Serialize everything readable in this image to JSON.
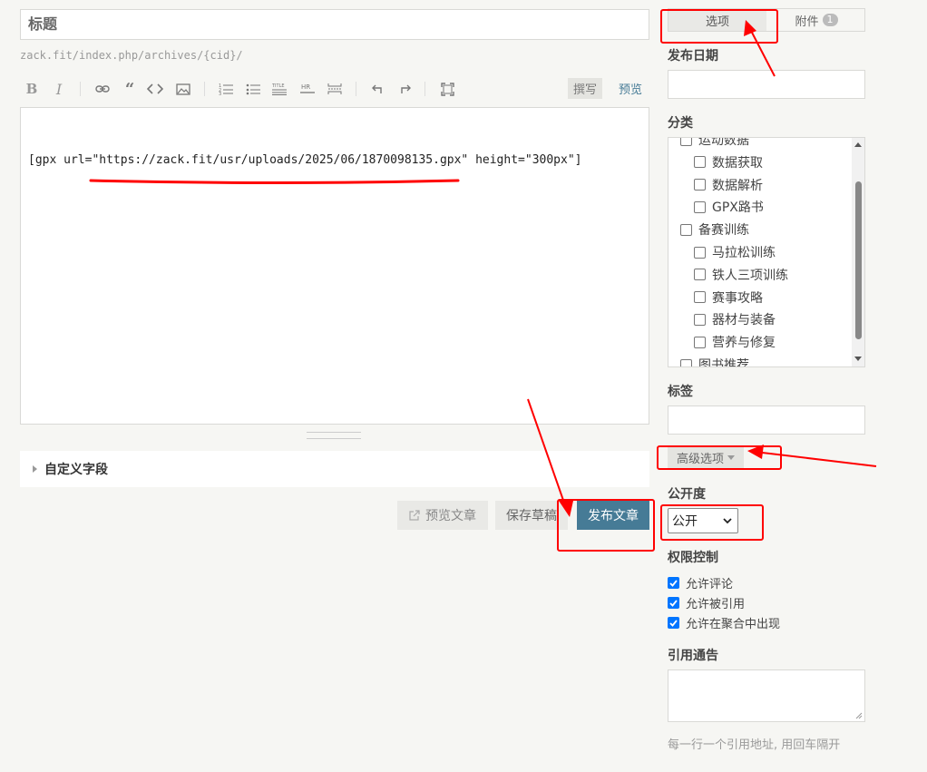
{
  "editor": {
    "title_placeholder": "标题",
    "permalink": "zack.fit/index.php/archives/{cid}/",
    "toolbar": {
      "bold": "B",
      "italic": "I",
      "write_tab": "撰写",
      "preview_tab": "预览"
    },
    "content": "[gpx url=\"https://zack.fit/usr/uploads/2025/06/1870098135.gpx\" height=\"300px\"]",
    "custom_fields_label": "自定义字段",
    "buttons": {
      "preview": "预览文章",
      "save_draft": "保存草稿",
      "publish": "发布文章"
    }
  },
  "sidebar": {
    "tabs": {
      "options": "选项",
      "attachments": "附件",
      "attachments_count": "1"
    },
    "publish_date_label": "发布日期",
    "category_label": "分类",
    "categories": [
      {
        "label": "运动数据",
        "level": 0
      },
      {
        "label": "数据获取",
        "level": 1
      },
      {
        "label": "数据解析",
        "level": 1
      },
      {
        "label": "GPX路书",
        "level": 1
      },
      {
        "label": "备赛训练",
        "level": 0
      },
      {
        "label": "马拉松训练",
        "level": 1
      },
      {
        "label": "铁人三项训练",
        "level": 1
      },
      {
        "label": "赛事攻略",
        "level": 1
      },
      {
        "label": "器材与装备",
        "level": 1
      },
      {
        "label": "营养与修复",
        "level": 1
      },
      {
        "label": "图书推荐",
        "level": 0
      }
    ],
    "tags_label": "标签",
    "advanced_options_label": "高级选项",
    "visibility_label": "公开度",
    "visibility_value": "公开",
    "permissions_label": "权限控制",
    "permissions": [
      {
        "label": "允许评论",
        "checked": true
      },
      {
        "label": "允许被引用",
        "checked": true
      },
      {
        "label": "允许在聚合中出现",
        "checked": true
      }
    ],
    "trackback_label": "引用通告",
    "trackback_hint": "每一行一个引用地址, 用回车隔开"
  },
  "colors": {
    "accent": "#467b96",
    "annotation": "#ff0000"
  }
}
